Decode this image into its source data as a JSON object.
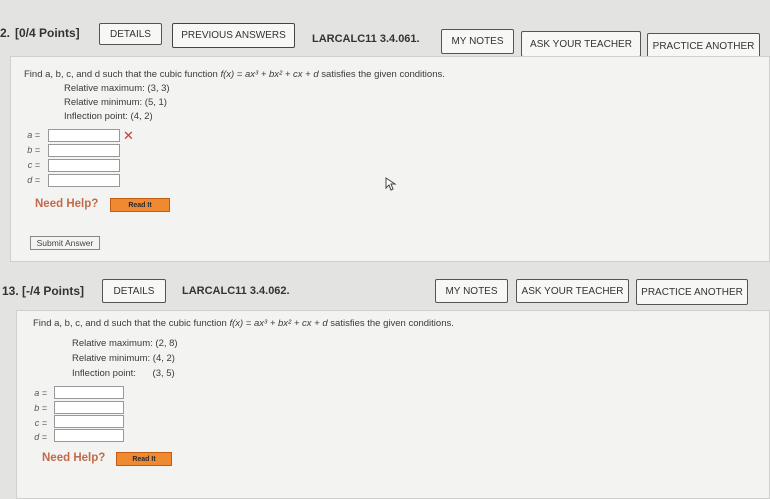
{
  "q12": {
    "number": "2.",
    "points": "[0/4 Points]",
    "details": "DETAILS",
    "previous": "PREVIOUS ANSWERS",
    "id": "LARCALC11 3.4.061.",
    "my_notes": "MY NOTES",
    "ask": "ASK YOUR TEACHER",
    "practice": "PRACTICE ANOTHER",
    "prompt_start": "Find a, b, c, and d such that the cubic function ",
    "prompt_func": "f(x) = ax³ + bx² + cx + d",
    "prompt_end": " satisfies the given conditions.",
    "conditions": [
      {
        "label": "Relative maximum:",
        "value": "(3, 3)"
      },
      {
        "label": "Relative minimum:",
        "value": "(5, 1)"
      },
      {
        "label": "Inflection point:",
        "value": "(4, 2)"
      }
    ],
    "fields": [
      {
        "label": "a =",
        "value": "",
        "wrong": true
      },
      {
        "label": "b =",
        "value": ""
      },
      {
        "label": "c =",
        "value": ""
      },
      {
        "label": "d =",
        "value": ""
      }
    ],
    "need_help": "Need Help?",
    "read_it": "Read It",
    "submit": "Submit Answer"
  },
  "q13": {
    "number": "13.",
    "points": "[-/4 Points]",
    "details": "DETAILS",
    "id": "LARCALC11 3.4.062.",
    "my_notes": "MY NOTES",
    "ask": "ASK YOUR TEACHER",
    "practice": "PRACTICE ANOTHER",
    "prompt_start": "Find a, b, c, and d such that the cubic function ",
    "prompt_func": "f(x) = ax³ + bx² + cx + d",
    "prompt_end": " satisfies the given conditions.",
    "conditions": [
      {
        "label": "Relative maximum:",
        "value": "(2, 8)"
      },
      {
        "label": "Relative minimum:",
        "value": "(4, 2)"
      },
      {
        "label": "Inflection point:",
        "value": "(3, 5)"
      }
    ],
    "fields": [
      {
        "label": "a =",
        "value": ""
      },
      {
        "label": "b =",
        "value": ""
      },
      {
        "label": "c =",
        "value": ""
      },
      {
        "label": "d =",
        "value": ""
      }
    ],
    "need_help": "Need Help?",
    "read_it": "Read It"
  },
  "icons": {
    "wrong": "x-mark-icon",
    "cursor": "mouse-pointer-icon"
  },
  "colors": {
    "wrong": "#d03a2f",
    "need_help": "#c26a4b",
    "read_it": "#f08a31"
  }
}
